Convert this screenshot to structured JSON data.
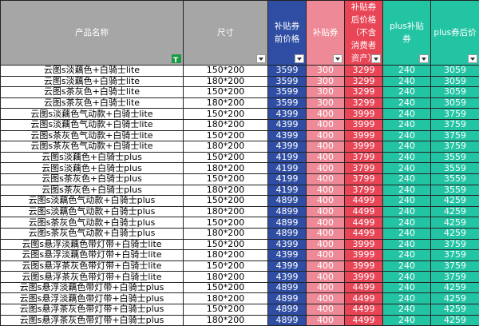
{
  "headers": {
    "name": "产品名称",
    "size": "尺寸",
    "price_before": "补贴券前价格",
    "coupon": "补贴券",
    "price_after": "补贴券后价格（不含消费者资产）",
    "plus_coupon": "plus补贴券",
    "plus_price": "plus券后价"
  },
  "rows": [
    {
      "name": "云图s淡藕色+白骑士lite",
      "size": "150*200",
      "p1": "3599",
      "p2": "300",
      "p3": "3299",
      "p4": "240",
      "p5": "3059"
    },
    {
      "name": "云图s淡藕色+白骑士lite",
      "size": "180*200",
      "p1": "3599",
      "p2": "300",
      "p3": "3299",
      "p4": "240",
      "p5": "3059"
    },
    {
      "name": "云图s茶灰色+白骑士lite",
      "size": "150*200",
      "p1": "3599",
      "p2": "300",
      "p3": "3299",
      "p4": "240",
      "p5": "3059"
    },
    {
      "name": "云图s茶灰色+白骑士lite",
      "size": "180*200",
      "p1": "3599",
      "p2": "300",
      "p3": "3299",
      "p4": "240",
      "p5": "3059"
    },
    {
      "name": "云图s淡藕色气动款+白骑士lite",
      "size": "150*200",
      "p1": "4399",
      "p2": "400",
      "p3": "3999",
      "p4": "240",
      "p5": "3759"
    },
    {
      "name": "云图s淡藕色气动款+白骑士lite",
      "size": "180*200",
      "p1": "4399",
      "p2": "400",
      "p3": "3999",
      "p4": "240",
      "p5": "3759"
    },
    {
      "name": "云图s茶灰色气动款+白骑士lite",
      "size": "150*200",
      "p1": "4399",
      "p2": "400",
      "p3": "3999",
      "p4": "240",
      "p5": "3759"
    },
    {
      "name": "云图s茶灰色气动款+白骑士lite",
      "size": "180*200",
      "p1": "4399",
      "p2": "400",
      "p3": "3999",
      "p4": "240",
      "p5": "3759"
    },
    {
      "name": "云图s淡藕色+白骑士plus",
      "size": "150*200",
      "p1": "4199",
      "p2": "400",
      "p3": "3799",
      "p4": "240",
      "p5": "3559"
    },
    {
      "name": "云图s淡藕色+白骑士plus",
      "size": "180*200",
      "p1": "4199",
      "p2": "400",
      "p3": "3799",
      "p4": "240",
      "p5": "3559"
    },
    {
      "name": "云图s茶灰色+白骑士plus",
      "size": "150*200",
      "p1": "4199",
      "p2": "400",
      "p3": "3799",
      "p4": "240",
      "p5": "3559"
    },
    {
      "name": "云图s茶灰色+白骑士plus",
      "size": "180*200",
      "p1": "4199",
      "p2": "400",
      "p3": "3799",
      "p4": "240",
      "p5": "3559"
    },
    {
      "name": "云图s淡藕色气动款+白骑士plus",
      "size": "150*200",
      "p1": "4899",
      "p2": "400",
      "p3": "4499",
      "p4": "240",
      "p5": "4259"
    },
    {
      "name": "云图s淡藕色气动款+白骑士plus",
      "size": "180*200",
      "p1": "4899",
      "p2": "400",
      "p3": "4499",
      "p4": "240",
      "p5": "4259"
    },
    {
      "name": "云图s茶灰色气动款+白骑士plus",
      "size": "150*200",
      "p1": "4899",
      "p2": "400",
      "p3": "4499",
      "p4": "240",
      "p5": "4259"
    },
    {
      "name": "云图s茶灰色气动款+白骑士plus",
      "size": "180*200",
      "p1": "4899",
      "p2": "400",
      "p3": "4499",
      "p4": "240",
      "p5": "4259"
    },
    {
      "name": "云图s悬浮淡藕色带灯带+白骑士lite",
      "size": "150*200",
      "p1": "4399",
      "p2": "400",
      "p3": "3999",
      "p4": "240",
      "p5": "3759"
    },
    {
      "name": "云图s悬浮淡藕色带灯带+白骑士lite",
      "size": "180*200",
      "p1": "4399",
      "p2": "400",
      "p3": "3999",
      "p4": "240",
      "p5": "3759"
    },
    {
      "name": "云图s悬浮茶灰色带灯带+白骑士lite",
      "size": "150*200",
      "p1": "4399",
      "p2": "400",
      "p3": "3999",
      "p4": "240",
      "p5": "3759"
    },
    {
      "name": "云图s悬浮茶灰色带灯带+白骑士lite",
      "size": "180*200",
      "p1": "4399",
      "p2": "400",
      "p3": "3999",
      "p4": "240",
      "p5": "3759"
    },
    {
      "name": "云图s悬浮淡藕色带灯带+白骑士plus",
      "size": "150*200",
      "p1": "4899",
      "p2": "400",
      "p3": "4499",
      "p4": "240",
      "p5": "4259"
    },
    {
      "name": "云图s悬浮淡藕色带灯带+白骑士plus",
      "size": "180*200",
      "p1": "4899",
      "p2": "400",
      "p3": "4499",
      "p4": "240",
      "p5": "4259"
    },
    {
      "name": "云图s悬浮茶灰色带灯带+白骑士plus",
      "size": "150*200",
      "p1": "4899",
      "p2": "400",
      "p3": "4499",
      "p4": "240",
      "p5": "4259"
    },
    {
      "name": "云图s悬浮茶灰色带灯带+白骑士plus",
      "size": "180*200",
      "p1": "4899",
      "p2": "400",
      "p3": "4499",
      "p4": "240",
      "p5": "4259"
    }
  ],
  "colors": {
    "header_gray": "#a6a6a6",
    "price_before_blue": "#2f4ea3",
    "coupon_pink": "#ee8a97",
    "price_after_red": "#e84556",
    "plus_teal": "#23c4a4",
    "filter_active_green": "#1a9a45"
  },
  "icons": {
    "name_filter": "filter-active-icon",
    "column_filter": "dropdown-filter-icon"
  }
}
